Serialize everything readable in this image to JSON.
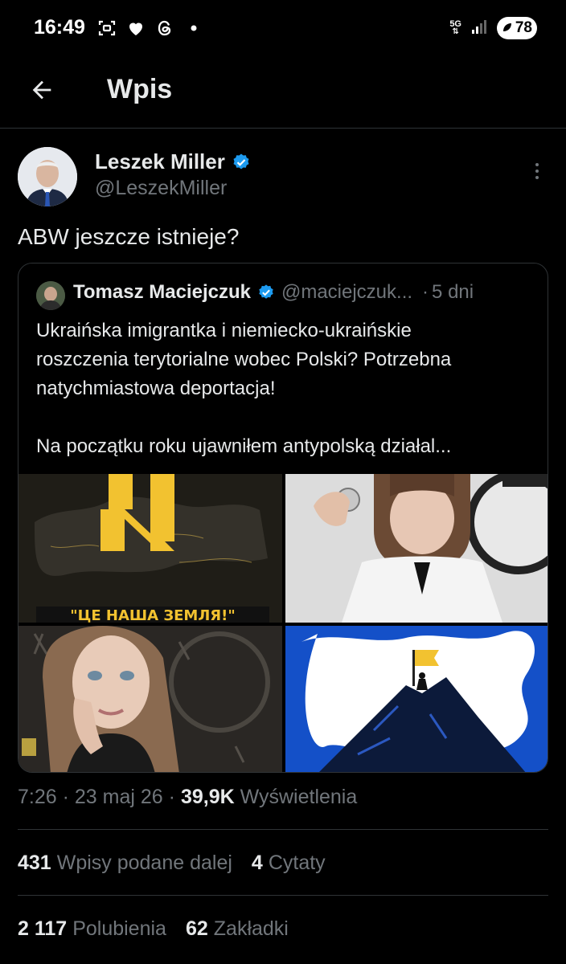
{
  "status_bar": {
    "time": "16:49",
    "network": "5G",
    "battery": "78"
  },
  "header": {
    "title": "Wpis"
  },
  "post": {
    "author_name": "Leszek Miller",
    "author_handle": "@LeszekMiller",
    "text": "ABW jeszcze istnieje?",
    "time": "7:26",
    "date": "23 maj 26",
    "views_count": "39,9K",
    "views_label": "Wyświetlenia",
    "reposts_count": "431",
    "reposts_label": "Wpisy podane dalej",
    "quotes_count": "4",
    "quotes_label": "Cytaty",
    "likes_count": "2 117",
    "likes_label": "Polubienia",
    "bookmarks_count": "62",
    "bookmarks_label": "Zakładki"
  },
  "quoted_post": {
    "author_name": "Tomasz Maciejczuk",
    "author_handle": "@maciejczuk...",
    "time_ago": "5 dni",
    "text_lines": [
      "Ukraińska imigrantka i niemiecko-ukraińskie",
      "roszczenia terytorialne wobec Polski? Potrzebna",
      "natychmiastowa deportacja!"
    ],
    "text_line_2": "Na początku roku ujawniłem antypolską działal...",
    "image_1_caption": "\"ЦЕ НАША ЗЕМЛЯ!\""
  },
  "colors": {
    "background": "#000000",
    "text_primary": "#e7e9ea",
    "text_secondary": "#71767b",
    "divider": "#2f3336",
    "verified": "#1d9bf0"
  },
  "icons": [
    "back-arrow-icon",
    "verified-badge-icon",
    "more-vertical-icon",
    "heart-icon",
    "threads-icon",
    "screenshot-icon",
    "signal-icon"
  ]
}
